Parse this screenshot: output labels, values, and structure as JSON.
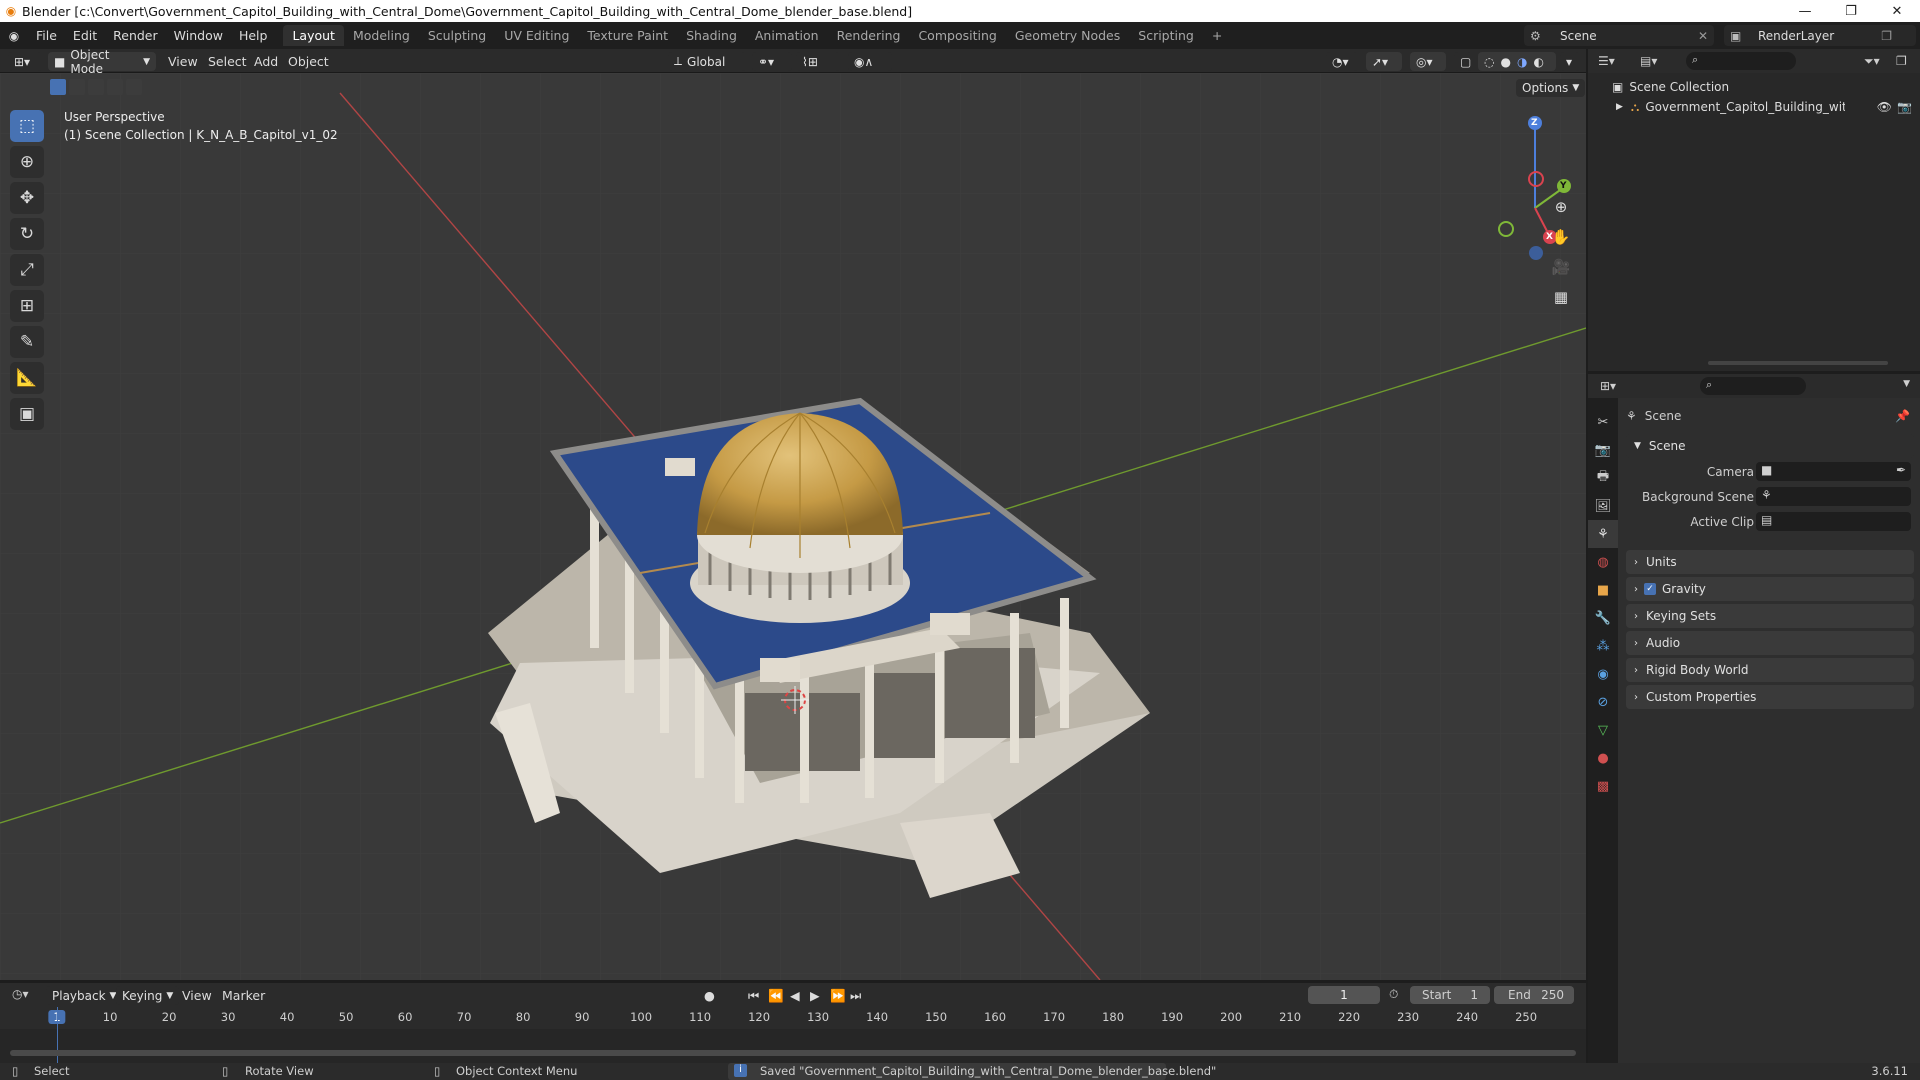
{
  "window": {
    "title": "Blender [c:\\Convert\\Government_Capitol_Building_with_Central_Dome\\Government_Capitol_Building_with_Central_Dome_blender_base.blend]",
    "controls": [
      "—",
      "❐",
      "✕"
    ]
  },
  "menu": [
    "File",
    "Edit",
    "Render",
    "Window",
    "Help"
  ],
  "workspaces": [
    "Layout",
    "Modeling",
    "Sculpting",
    "UV Editing",
    "Texture Paint",
    "Shading",
    "Animation",
    "Rendering",
    "Compositing",
    "Geometry Nodes",
    "Scripting",
    "+"
  ],
  "active_workspace": "Layout",
  "scene_selector": "Scene",
  "renderlayer_selector": "RenderLayer",
  "viewport_header": {
    "mode": "Object Mode",
    "menus": [
      "View",
      "Select",
      "Add",
      "Object"
    ],
    "orientation": "Global",
    "options": "Options"
  },
  "viewport": {
    "view_name": "User Perspective",
    "collection_info": "(1) Scene Collection | K_N_A_B_Capitol_v1_02",
    "gizmo": {
      "z": "Z",
      "y": "Y",
      "x": "X"
    },
    "accent_red": "#c84a4a",
    "accent_green": "#6f9a2e"
  },
  "tools": [
    "select-box",
    "cursor",
    "move",
    "rotate",
    "scale",
    "transform",
    "annotate",
    "measure",
    "add-cube"
  ],
  "outliner": {
    "root": "Scene Collection",
    "items": [
      {
        "label": "Government_Capitol_Building_with_Cer"
      }
    ]
  },
  "properties": {
    "context": "Scene",
    "panel_scene": "Scene",
    "fields": [
      {
        "label": "Camera"
      },
      {
        "label": "Background Scene"
      },
      {
        "label": "Active Clip"
      }
    ],
    "panels": [
      "Units",
      "Gravity",
      "Keying Sets",
      "Audio",
      "Rigid Body World",
      "Custom Properties"
    ],
    "gravity_checked": true
  },
  "timeline": {
    "menus": [
      "Playback",
      "Keying",
      "View",
      "Marker"
    ],
    "current_frame": "1",
    "start_label": "Start",
    "start": "1",
    "end_label": "End",
    "end": "250",
    "ticks": [
      "1",
      "10",
      "20",
      "30",
      "40",
      "50",
      "60",
      "70",
      "80",
      "90",
      "100",
      "110",
      "120",
      "130",
      "140",
      "150",
      "160",
      "170",
      "180",
      "190",
      "200",
      "210",
      "220",
      "230",
      "240",
      "250"
    ]
  },
  "statusbar": {
    "select": "Select",
    "rotate": "Rotate View",
    "context_menu": "Object Context Menu",
    "message": "Saved \"Government_Capitol_Building_with_Central_Dome_blender_base.blend\"",
    "version": "3.6.11"
  }
}
